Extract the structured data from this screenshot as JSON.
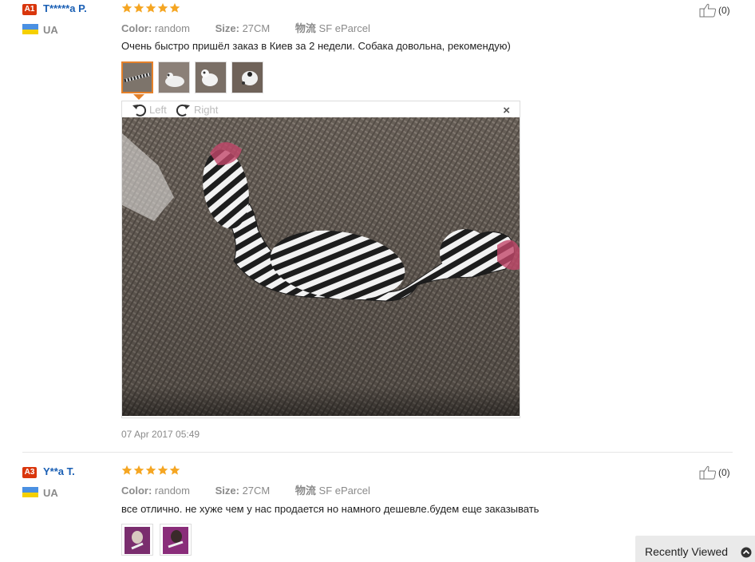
{
  "reviews": [
    {
      "badge": "A1",
      "user": "T*****a P.",
      "country": "UA",
      "rating": 5,
      "color_label": "Color:",
      "color_value": "random",
      "size_label": "Size:",
      "size_value": "27CM",
      "ship_label": "物流",
      "ship_value": "SF eParcel",
      "text": "Очень быстро пришёл заказ в Киев за 2 недели. Собака довольна, рекомендую)",
      "helpful": "(0)",
      "date": "07 Apr 2017 05:49"
    },
    {
      "badge": "A3",
      "user": "Y**a T.",
      "country": "UA",
      "rating": 5,
      "color_label": "Color:",
      "color_value": "random",
      "size_label": "Size:",
      "size_value": "27CM",
      "ship_label": "物流",
      "ship_value": "SF eParcel",
      "text": "все отлично. не хуже чем у нас продается но намного дешевле.будем еще заказывать",
      "helpful": "(0)"
    }
  ],
  "viewer": {
    "rotate_left": "Left",
    "rotate_right": "Right",
    "close": "×"
  },
  "recently_viewed": "Recently Viewed",
  "colors": {
    "accent": "#e5812a",
    "star": "#f5a623",
    "badge": "#d9360c",
    "username": "#1a5fb4"
  }
}
